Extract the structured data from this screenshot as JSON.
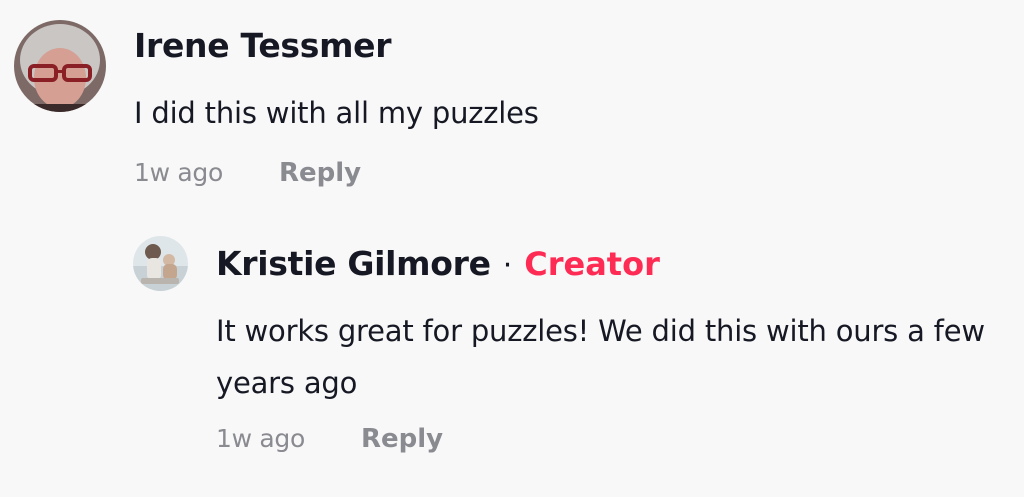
{
  "comments": [
    {
      "author": "Irene Tessmer",
      "text": "I did this with all my puzzles",
      "time": "1w ago",
      "reply_label": "Reply"
    }
  ],
  "reply": {
    "author": "Kristie Gilmore",
    "separator": "·",
    "badge": "Creator",
    "text": "It works great for puzzles! We did this with ours a few years ago",
    "time": "1w ago",
    "reply_label": "Reply"
  },
  "colors": {
    "background": "#f8f8f8",
    "text": "#161823",
    "muted": "#8a8b91",
    "creator_badge": "#fe2c55"
  }
}
